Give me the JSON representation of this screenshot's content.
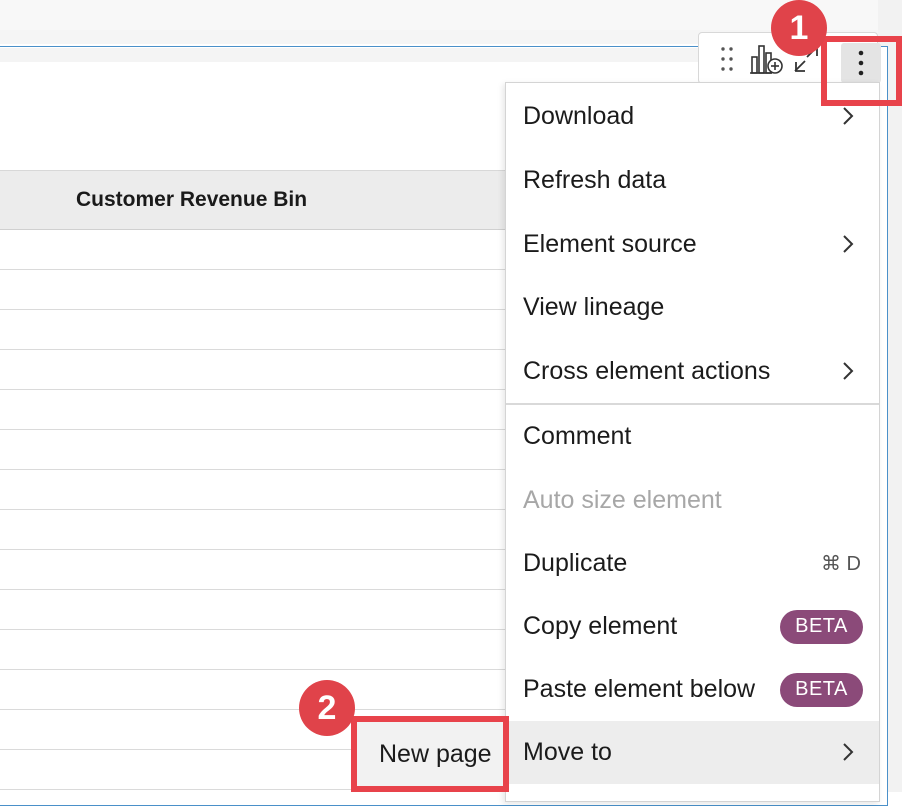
{
  "table": {
    "column_header": "Customer Revenue Bin"
  },
  "toolbar": {
    "icons": [
      "drag-handle-icon",
      "add-chart-icon",
      "collapse-icon",
      "more-vertical-icon"
    ]
  },
  "menu": {
    "download": "Download",
    "refresh_data": "Refresh data",
    "element_source": "Element source",
    "view_lineage": "View lineage",
    "cross_element_actions": "Cross element actions",
    "comment": "Comment",
    "auto_size_element": "Auto size element",
    "duplicate": "Duplicate",
    "duplicate_shortcut": "⌘ D",
    "copy_element": "Copy element",
    "copy_element_badge": "BETA",
    "paste_element_below": "Paste element below",
    "paste_element_below_badge": "BETA",
    "move_to": "Move to"
  },
  "submenu": {
    "new_page": "New page"
  },
  "annotations": {
    "step1": "1",
    "step2": "2"
  },
  "colors": {
    "callout_red": "#e8434b",
    "beta_purple": "#8b4a79",
    "frame_blue": "#4a90c9"
  }
}
